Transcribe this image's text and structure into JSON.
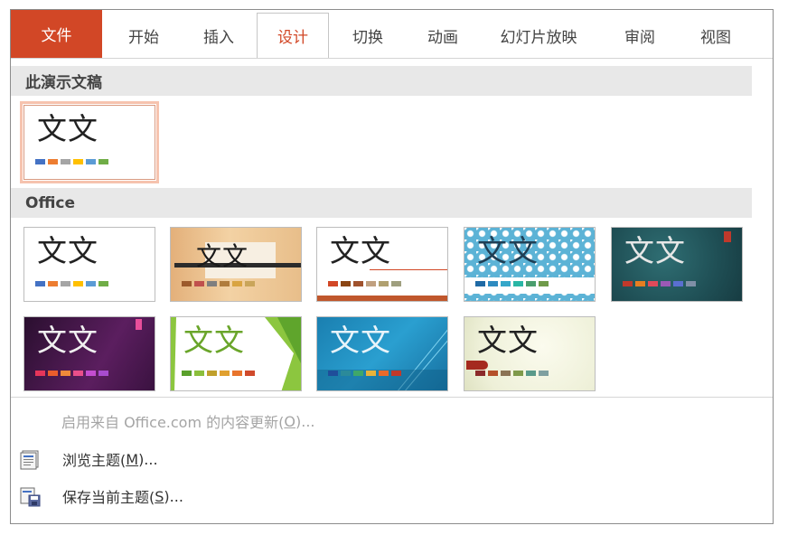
{
  "ribbon": {
    "tabs": [
      {
        "label": "文件",
        "name": "tab-file"
      },
      {
        "label": "开始",
        "name": "tab-home"
      },
      {
        "label": "插入",
        "name": "tab-insert"
      },
      {
        "label": "设计",
        "name": "tab-design"
      },
      {
        "label": "切换",
        "name": "tab-transitions"
      },
      {
        "label": "动画",
        "name": "tab-animations"
      },
      {
        "label": "幻灯片放映",
        "name": "tab-slideshow"
      },
      {
        "label": "审阅",
        "name": "tab-review"
      },
      {
        "label": "视图",
        "name": "tab-view"
      }
    ],
    "active_tab": "设计"
  },
  "gallery": {
    "current_section": {
      "title": "此演示文稿",
      "themes": [
        {
          "text": "文文",
          "colors": [
            "#4472c4",
            "#ed7d31",
            "#a5a5a5",
            "#ffc000",
            "#5b9bd5",
            "#70ad47"
          ]
        }
      ]
    },
    "office_section": {
      "title": "Office",
      "themes": [
        {
          "text": "文文",
          "colors": [
            "#4472c4",
            "#ed7d31",
            "#a5a5a5",
            "#ffc000",
            "#5b9bd5",
            "#70ad47"
          ]
        },
        {
          "text": "文文",
          "colors": [
            "#9c5a2c",
            "#c0504d",
            "#7f7f7f",
            "#b07c3c",
            "#d9a441",
            "#c9a55a"
          ]
        },
        {
          "text": "文文",
          "colors": [
            "#d24726",
            "#8b4513",
            "#a0522d",
            "#c0a080",
            "#b0a070",
            "#9f9f7f"
          ]
        },
        {
          "text": "文文",
          "colors": [
            "#1f6aa5",
            "#2e8bc0",
            "#35a7c9",
            "#29b6a5",
            "#4a9e6e",
            "#6f9a4a"
          ]
        },
        {
          "text": "文文",
          "colors": [
            "#c0392b",
            "#e67e22",
            "#e04a5a",
            "#9b59b6",
            "#5a6fd0",
            "#7f8fa6"
          ]
        },
        {
          "text": "文文",
          "colors": [
            "#e5355a",
            "#e85d2c",
            "#f08a3a",
            "#e94f8a",
            "#c34dd0",
            "#a84ccf"
          ]
        },
        {
          "text": "文文",
          "colors": [
            "#5aa02c",
            "#8bbf3c",
            "#c0a02c",
            "#e0a030",
            "#e8742c",
            "#d04a2c"
          ]
        },
        {
          "text": "文文",
          "colors": [
            "#1f4e9a",
            "#2b8a9a",
            "#3fa76a",
            "#e8b33a",
            "#e86a2a",
            "#c0392b"
          ]
        },
        {
          "text": "文文",
          "colors": [
            "#8b2a2a",
            "#b5502a",
            "#8b7355",
            "#7f9a4a",
            "#5a9a8a",
            "#7fa0a0"
          ]
        }
      ]
    }
  },
  "menu": {
    "items": [
      {
        "label": "启用来自 Office.com 的内容更新(",
        "key": "O",
        "suffix": ")...",
        "disabled": true,
        "icon": ""
      },
      {
        "label": "浏览主题(",
        "key": "M",
        "suffix": ")...",
        "disabled": false,
        "icon": "browse-themes-icon"
      },
      {
        "label": "保存当前主题(",
        "key": "S",
        "suffix": ")...",
        "disabled": false,
        "icon": "save-theme-icon"
      }
    ]
  }
}
